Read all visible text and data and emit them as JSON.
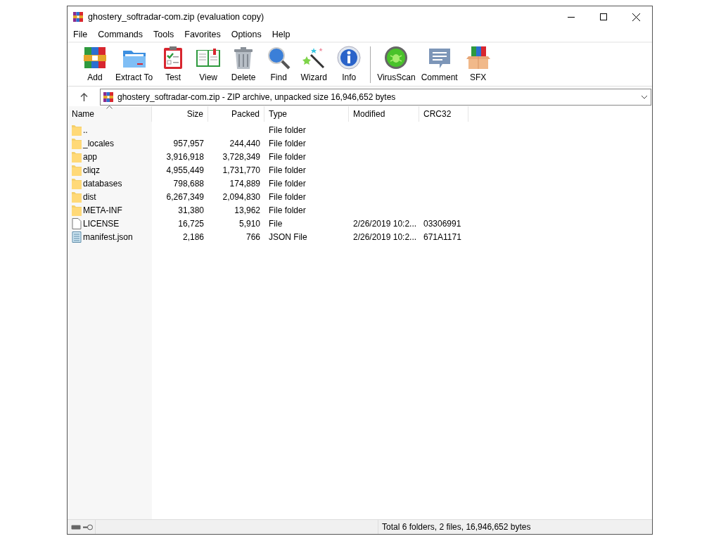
{
  "window": {
    "title": "ghostery_softradar-com.zip (evaluation copy)"
  },
  "menu": [
    "File",
    "Commands",
    "Tools",
    "Favorites",
    "Options",
    "Help"
  ],
  "toolbar": [
    {
      "kind": "add",
      "label": "Add"
    },
    {
      "kind": "extract",
      "label": "Extract To"
    },
    {
      "kind": "test",
      "label": "Test"
    },
    {
      "kind": "view",
      "label": "View"
    },
    {
      "kind": "delete",
      "label": "Delete"
    },
    {
      "kind": "find",
      "label": "Find"
    },
    {
      "kind": "wizard",
      "label": "Wizard"
    },
    {
      "kind": "info",
      "label": "Info"
    },
    {
      "kind": "virusscan",
      "label": "VirusScan"
    },
    {
      "kind": "comment",
      "label": "Comment"
    },
    {
      "kind": "sfx",
      "label": "SFX"
    }
  ],
  "address": {
    "value": "ghostery_softradar-com.zip - ZIP archive, unpacked size 16,946,652 bytes"
  },
  "table": {
    "columns": [
      {
        "label": "Name",
        "sorted": true
      },
      {
        "label": "Size",
        "sorted": false
      },
      {
        "label": "Packed",
        "sorted": false
      },
      {
        "label": "Type",
        "sorted": false
      },
      {
        "label": "Modified",
        "sorted": false
      },
      {
        "label": "CRC32",
        "sorted": false
      }
    ],
    "rows": [
      {
        "kind": "folder",
        "name": "..",
        "size": "",
        "packed": "",
        "type": "File folder",
        "modified": "",
        "crc": ""
      },
      {
        "kind": "folder",
        "name": "_locales",
        "size": "957,957",
        "packed": "244,440",
        "type": "File folder",
        "modified": "",
        "crc": ""
      },
      {
        "kind": "folder",
        "name": "app",
        "size": "3,916,918",
        "packed": "3,728,349",
        "type": "File folder",
        "modified": "",
        "crc": ""
      },
      {
        "kind": "folder",
        "name": "cliqz",
        "size": "4,955,449",
        "packed": "1,731,770",
        "type": "File folder",
        "modified": "",
        "crc": ""
      },
      {
        "kind": "folder",
        "name": "databases",
        "size": "798,688",
        "packed": "174,889",
        "type": "File folder",
        "modified": "",
        "crc": ""
      },
      {
        "kind": "folder",
        "name": "dist",
        "size": "6,267,349",
        "packed": "2,094,830",
        "type": "File folder",
        "modified": "",
        "crc": ""
      },
      {
        "kind": "folder",
        "name": "META-INF",
        "size": "31,380",
        "packed": "13,962",
        "type": "File folder",
        "modified": "",
        "crc": ""
      },
      {
        "kind": "file",
        "name": "LICENSE",
        "size": "16,725",
        "packed": "5,910",
        "type": "File",
        "modified": "2/26/2019 10:2...",
        "crc": "03306991"
      },
      {
        "kind": "json",
        "name": "manifest.json",
        "size": "2,186",
        "packed": "766",
        "type": "JSON File",
        "modified": "2/26/2019 10:2...",
        "crc": "671A1171"
      }
    ]
  },
  "status_bar": {
    "text": "Total 6 folders, 2 files, 16,946,652 bytes"
  }
}
